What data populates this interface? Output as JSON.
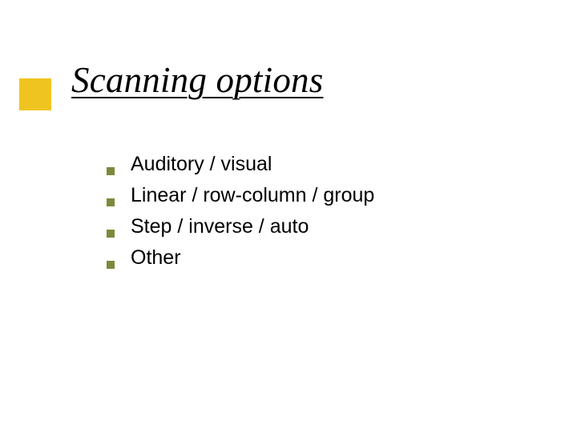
{
  "title": "Scanning options",
  "bullets": [
    {
      "text": "Auditory / visual"
    },
    {
      "text": "Linear / row-column / group"
    },
    {
      "text": "Step / inverse / auto"
    },
    {
      "text": "Other"
    }
  ],
  "colors": {
    "accent": "#f0c420",
    "bullet": "#7b8a3a"
  }
}
